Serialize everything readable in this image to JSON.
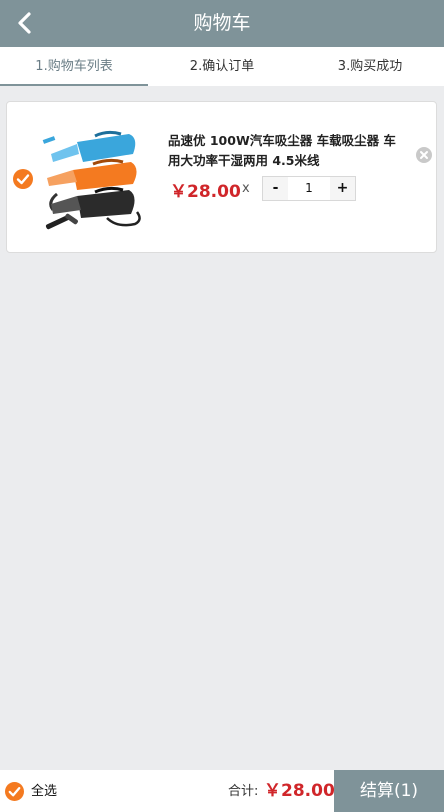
{
  "header": {
    "title": "购物车"
  },
  "steps": [
    {
      "label": "1.购物车列表"
    },
    {
      "label": "2.确认订单"
    },
    {
      "label": "3.购买成功"
    }
  ],
  "cart": {
    "items": [
      {
        "title": "品速优 100W汽车吸尘器 车载吸尘器 车用大功率干湿两用 4.5米线",
        "price": "￥28.00",
        "times": "x",
        "quantity": "1",
        "minus": "-",
        "plus": "+"
      }
    ]
  },
  "footer": {
    "select_all": "全选",
    "total_label": "合计:",
    "total_value": "￥28.00",
    "checkout": "结算(1)"
  },
  "colors": {
    "accent": "#7f9399",
    "check": "#f47a20",
    "price": "#d0262a"
  }
}
